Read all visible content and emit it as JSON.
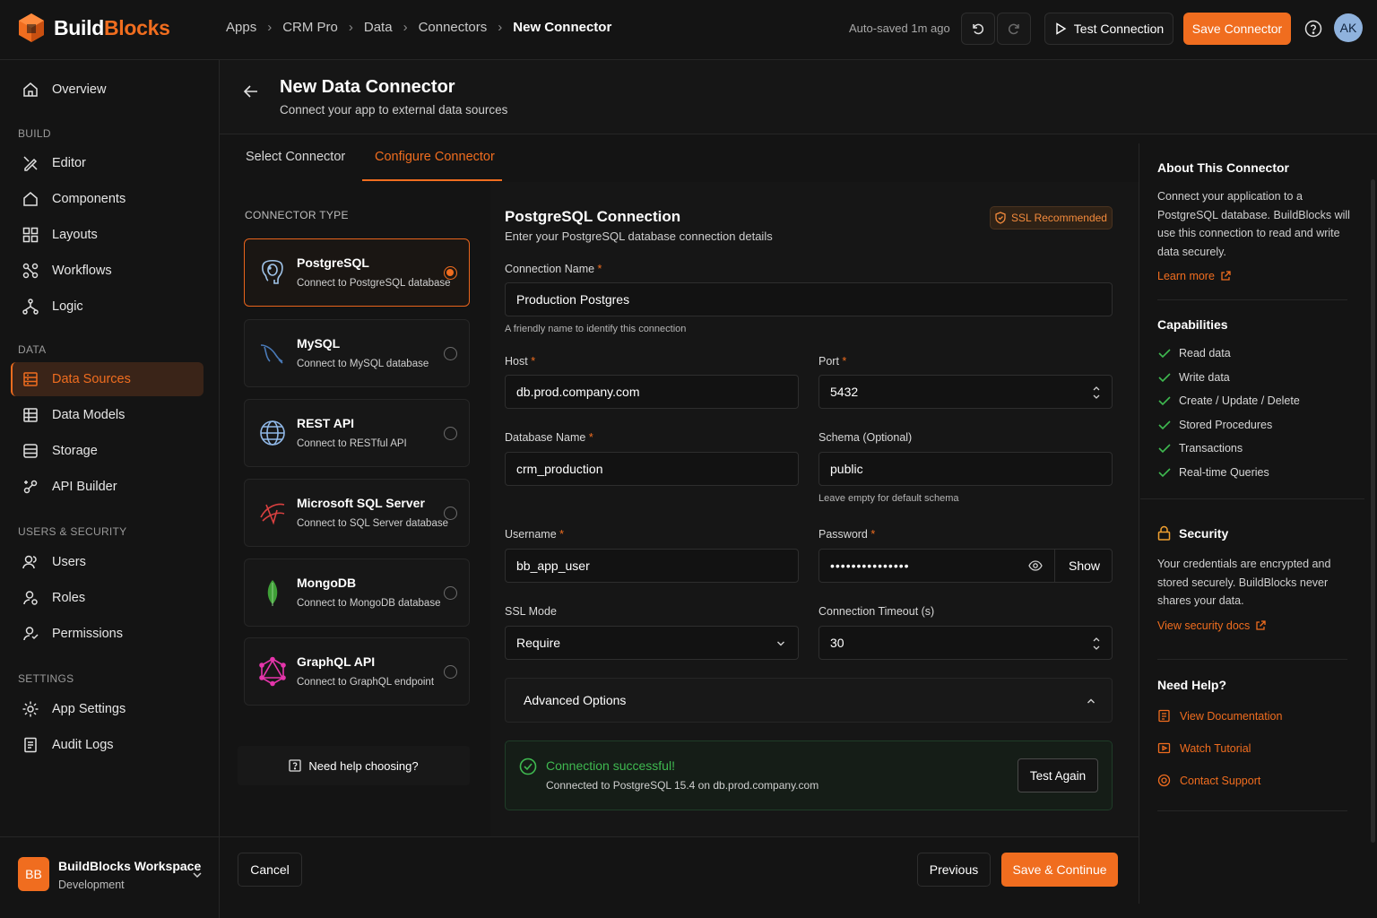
{
  "brand": {
    "name_part1": "Build",
    "name_part2": "Blocks"
  },
  "breadcrumb": [
    "Apps",
    "CRM Pro",
    "Data",
    "Connectors",
    "New Connector"
  ],
  "topbar": {
    "autosave": "Auto-saved 1m ago",
    "test_connection": "Test Connection",
    "save_connector": "Save Connector",
    "avatar": "AK"
  },
  "sidebar": {
    "overview": "Overview",
    "sections": {
      "build": "BUILD",
      "data": "DATA",
      "users_security": "USERS & SECURITY",
      "settings": "SETTINGS"
    },
    "build_items": [
      "Editor",
      "Components",
      "Layouts",
      "Workflows",
      "Logic"
    ],
    "data_items": [
      "Data Sources",
      "Data Models",
      "Storage",
      "API Builder"
    ],
    "security_items": [
      "Users",
      "Roles",
      "Permissions"
    ],
    "settings_items": [
      "App Settings",
      "Audit Logs"
    ],
    "active": "Data Sources",
    "workspace": {
      "badge": "BB",
      "name": "BuildBlocks Workspace",
      "env": "Development"
    }
  },
  "page": {
    "title": "New Data Connector",
    "subtitle": "Connect your app to external data sources"
  },
  "tabs": [
    {
      "label": "Select Connector",
      "active": false
    },
    {
      "label": "Configure Connector",
      "active": true
    }
  ],
  "connector_type_label": "CONNECTOR TYPE",
  "connectors": [
    {
      "name": "PostgreSQL",
      "desc": "Connect to PostgreSQL database",
      "selected": true
    },
    {
      "name": "MySQL",
      "desc": "Connect to MySQL database",
      "selected": false
    },
    {
      "name": "REST API",
      "desc": "Connect to RESTful API",
      "selected": false
    },
    {
      "name": "Microsoft SQL Server",
      "desc": "Connect to SQL Server database",
      "selected": false
    },
    {
      "name": "MongoDB",
      "desc": "Connect to MongoDB database",
      "selected": false
    },
    {
      "name": "GraphQL API",
      "desc": "Connect to GraphQL endpoint",
      "selected": false
    }
  ],
  "need_help_choosing": "Need help choosing?",
  "form": {
    "title": "PostgreSQL Connection",
    "subtitle": "Enter your PostgreSQL database connection details",
    "ssl_badge": "SSL Recommended",
    "connection_name": {
      "label": "Connection Name",
      "value": "Production Postgres",
      "hint": "A friendly name to identify this connection"
    },
    "host": {
      "label": "Host",
      "value": "db.prod.company.com"
    },
    "port": {
      "label": "Port",
      "value": "5432"
    },
    "database": {
      "label": "Database Name",
      "value": "crm_production"
    },
    "schema": {
      "label": "Schema (Optional)",
      "value": "public",
      "hint": "Leave empty for default schema"
    },
    "username": {
      "label": "Username",
      "value": "bb_app_user"
    },
    "password": {
      "label": "Password",
      "value": "•••••••••••••••",
      "show": "Show"
    },
    "ssl_mode": {
      "label": "SSL Mode",
      "value": "Require"
    },
    "timeout": {
      "label": "Connection Timeout (s)",
      "value": "30"
    },
    "required_mark": "*",
    "advanced": "Advanced Options"
  },
  "status": {
    "title": "Connection successful!",
    "detail": "Connected to PostgreSQL 15.4 on db.prod.company.com",
    "test_again": "Test Again",
    "color": "#3fb950"
  },
  "footer": {
    "cancel": "Cancel",
    "previous": "Previous",
    "save_continue": "Save & Continue"
  },
  "about": {
    "title": "About This Connector",
    "text": "Connect your application to a PostgreSQL database. BuildBlocks will use this connection to read and write data securely.",
    "learn_more": "Learn more"
  },
  "capabilities": {
    "title": "Capabilities",
    "items": [
      "Read data",
      "Write data",
      "Create / Update / Delete",
      "Stored Procedures",
      "Transactions",
      "Real-time Queries"
    ]
  },
  "security": {
    "title": "Security",
    "text": "Your credentials are encrypted and stored securely. BuildBlocks never shares your data.",
    "link": "View security docs"
  },
  "help": {
    "title": "Need Help?",
    "items": [
      "View Documentation",
      "Watch Tutorial",
      "Contact Support"
    ]
  },
  "colors": {
    "accent": "#f06d1f",
    "background": "#141414",
    "success": "#3fb950"
  }
}
